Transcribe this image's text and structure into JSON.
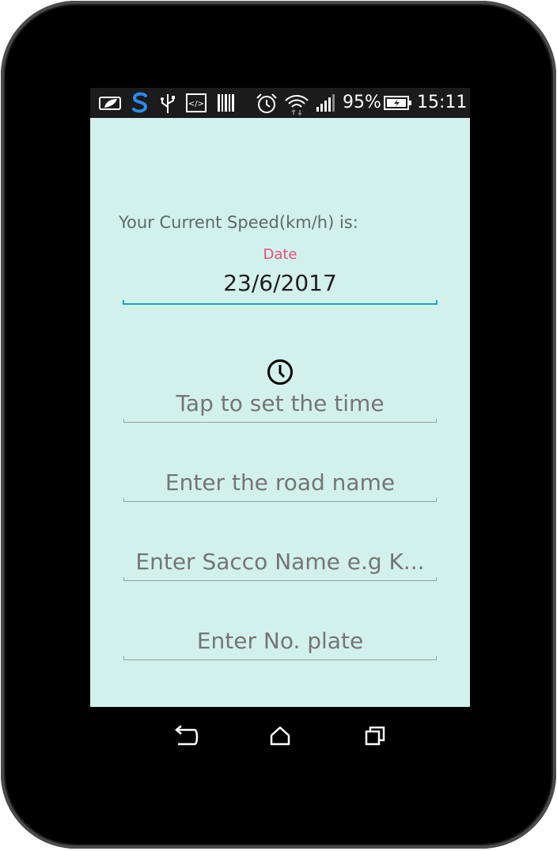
{
  "status_bar": {
    "battery_percent": "95%",
    "time": "15:11",
    "icons": [
      "battery-saver-icon",
      "swiftkey-icon",
      "usb-icon",
      "developer-icon",
      "barcode-icon",
      "alarm-icon",
      "wifi-icon",
      "signal-icon",
      "battery-charging-icon"
    ]
  },
  "form": {
    "speed_label": "Your Current Speed(km/h) is:",
    "date_label": "Date",
    "date_value": "23/6/2017",
    "time_placeholder": "Tap to set the time",
    "road_placeholder": "Enter the road name",
    "sacco_placeholder": "Enter Sacco Name e.g K...",
    "plate_placeholder": "Enter No. plate"
  },
  "nav_bar": {
    "icons": [
      "back-icon",
      "home-icon",
      "recents-icon"
    ]
  },
  "colors": {
    "screen_background": "#d3f1ec",
    "accent": "#ee4c7c",
    "underline_active": "#1aa2cf"
  }
}
